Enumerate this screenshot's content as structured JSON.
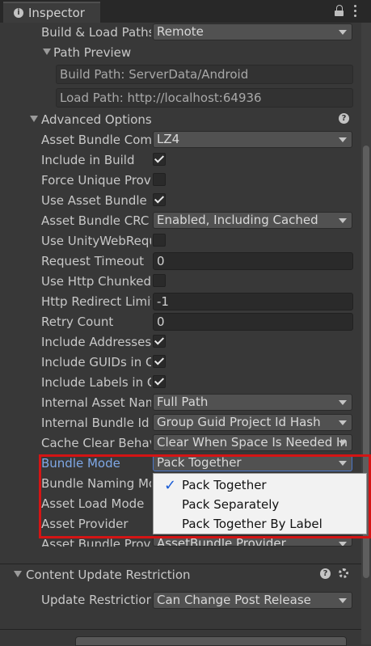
{
  "window": {
    "tab_title": "Inspector"
  },
  "rows": {
    "build_load_paths": {
      "label": "Build & Load Paths",
      "value": "Remote"
    },
    "path_preview": {
      "label": "Path Preview"
    },
    "build_path": "Build Path: ServerData/Android",
    "load_path": "Load Path: http://localhost:64936",
    "advanced_options": {
      "label": "Advanced Options"
    },
    "asset_bundle_compression": {
      "label": "Asset Bundle Compression",
      "value": "LZ4"
    },
    "include_in_build": {
      "label": "Include in Build",
      "checked": true
    },
    "force_unique_provider": {
      "label": "Force Unique Provider",
      "checked": false
    },
    "use_asset_bundle_cache": {
      "label": "Use Asset Bundle Cache",
      "checked": true
    },
    "asset_bundle_crc": {
      "label": "Asset Bundle CRC",
      "value": "Enabled, Including Cached"
    },
    "use_unitywebrequest": {
      "label": "Use UnityWebRequest",
      "checked": false
    },
    "request_timeout": {
      "label": "Request Timeout",
      "value": "0"
    },
    "use_http_chunked": {
      "label": "Use Http Chunked",
      "checked": false
    },
    "http_redirect_limit": {
      "label": "Http Redirect Limit",
      "value": "-1"
    },
    "retry_count": {
      "label": "Retry Count",
      "value": "0"
    },
    "include_addresses": {
      "label": "Include Addresses",
      "checked": true
    },
    "include_guids": {
      "label": "Include GUIDs in Catalog",
      "checked": true
    },
    "include_labels": {
      "label": "Include Labels in Catalog",
      "checked": true
    },
    "internal_asset_naming": {
      "label": "Internal Asset Naming",
      "value": "Full Path"
    },
    "internal_bundle_id": {
      "label": "Internal Bundle Id Mode",
      "value": "Group Guid Project Id Hash"
    },
    "cache_clear_behavior": {
      "label": "Cache Clear Behavior",
      "value": "Clear When Space Is Needed In Cache"
    },
    "bundle_mode": {
      "label": "Bundle Mode",
      "value": "Pack Together"
    },
    "bundle_naming_mode": {
      "label": "Bundle Naming Mode"
    },
    "asset_load_mode": {
      "label": "Asset Load Mode"
    },
    "asset_provider": {
      "label": "Asset Provider"
    },
    "asset_bundle_provider": {
      "label": "Asset Bundle Provider",
      "value": "AssetBundle Provider"
    }
  },
  "bundle_mode_menu": {
    "options": [
      "Pack Together",
      "Pack Separately",
      "Pack Together By Label"
    ],
    "selected": "Pack Together"
  },
  "content_update": {
    "header": "Content Update Restriction",
    "update_restriction": {
      "label": "Update Restriction",
      "value": "Can Change Post Release"
    }
  },
  "icons": {
    "inspector": "info-icon",
    "lock": "lock-icon",
    "menu": "kebab-menu-icon",
    "help": "help-icon",
    "settings": "gear-icon"
  },
  "colors": {
    "accent_label": "#7fa8e6",
    "highlight_box": "#d41414",
    "checkmark": "#1a5cd6"
  }
}
